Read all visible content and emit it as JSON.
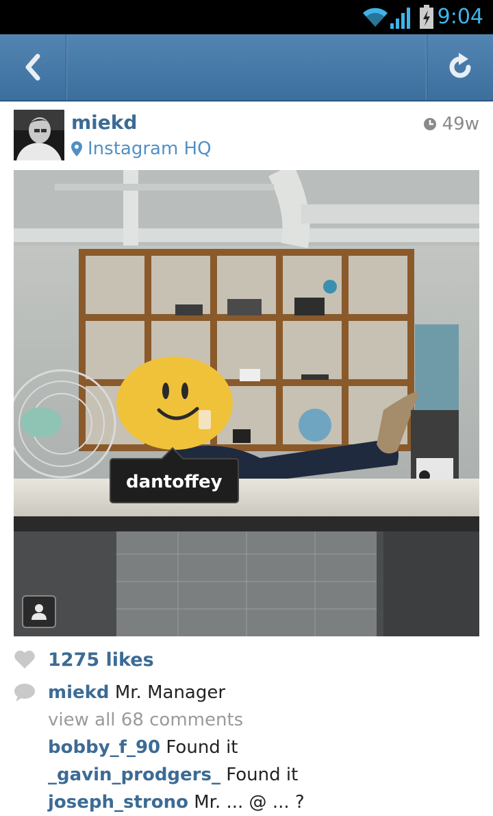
{
  "status_bar": {
    "time": "9:04",
    "icons": [
      "wifi-icon",
      "signal-icon",
      "battery-charging-icon"
    ]
  },
  "action_bar": {
    "back_icon": "chevron-left-icon",
    "refresh_icon": "refresh-icon",
    "color": "#4a7bab"
  },
  "post": {
    "username": "miekd",
    "location": "Instagram HQ",
    "timestamp": "49w",
    "tag_label": "dantoffey",
    "likes": "1275 likes",
    "caption": {
      "user": "miekd",
      "text": "Mr. Manager"
    },
    "view_all": "view all 68 comments",
    "comments": [
      {
        "user": "bobby_f_90",
        "text": "Found it"
      },
      {
        "user": "_gavin_prodgers_",
        "text": "Found it"
      },
      {
        "user": "joseph_strono",
        "text": "Mr. ... @ ... ?"
      }
    ]
  },
  "colors": {
    "username": "#3c6b95",
    "location": "#5190c6",
    "status_time": "#3fb4ea",
    "muted": "#9a9a9a"
  }
}
